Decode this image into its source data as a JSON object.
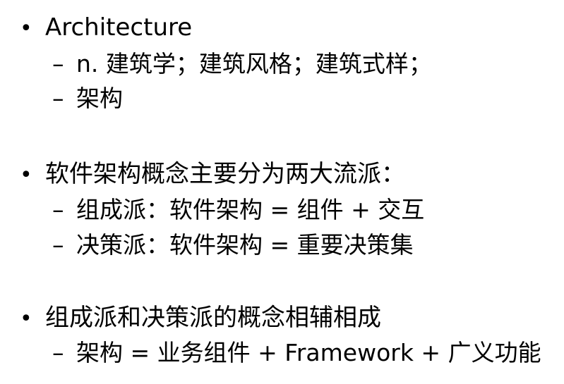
{
  "bullet_symbol": "•",
  "dash_symbol": "–",
  "sections": [
    {
      "title": "Architecture",
      "items": [
        "n. 建筑学；建筑风格；建筑式样；",
        "架构"
      ]
    },
    {
      "title": "软件架构概念主要分为两大流派：",
      "items": [
        "组成派：软件架构 = 组件 + 交互",
        "决策派：软件架构 = 重要决策集"
      ]
    },
    {
      "title": "组成派和决策派的概念相辅相成",
      "items": [
        "架构 = 业务组件 + Framework + 广义功能"
      ]
    }
  ]
}
